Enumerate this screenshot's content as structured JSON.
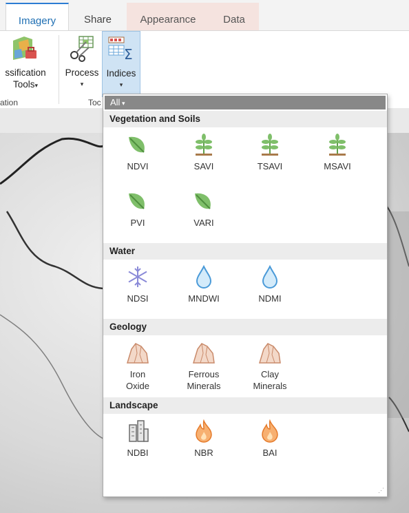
{
  "tabs": [
    {
      "label": "Imagery",
      "active": true
    },
    {
      "label": "Share"
    },
    {
      "label": "Appearance"
    },
    {
      "label": "Data"
    }
  ],
  "ribbon": {
    "classification": {
      "line1": "ssification",
      "line2": "Tools"
    },
    "process": {
      "label": "Process"
    },
    "indices": {
      "label": "Indices"
    },
    "group_left": "ation",
    "group_tools": "Toc"
  },
  "gallery": {
    "filter": "All",
    "sections": [
      {
        "title": "Vegetation and Soils",
        "items": [
          {
            "label": "NDVI",
            "icon": "leaf-icon"
          },
          {
            "label": "SAVI",
            "icon": "plant-icon"
          },
          {
            "label": "TSAVI",
            "icon": "plant-icon"
          },
          {
            "label": "MSAVI",
            "icon": "plant-icon"
          },
          {
            "label": "PVI",
            "icon": "leaf-icon"
          },
          {
            "label": "VARI",
            "icon": "leaf-icon"
          }
        ]
      },
      {
        "title": "Water",
        "items": [
          {
            "label": "NDSI",
            "icon": "snowflake-icon"
          },
          {
            "label": "MNDWI",
            "icon": "water-drop-icon"
          },
          {
            "label": "NDMI",
            "icon": "water-drop-icon"
          }
        ]
      },
      {
        "title": "Geology",
        "items": [
          {
            "label": "Iron\nOxide",
            "line1": "Iron",
            "line2": "Oxide",
            "icon": "rock-icon"
          },
          {
            "label": "Ferrous\nMinerals",
            "line1": "Ferrous",
            "line2": "Minerals",
            "icon": "rock-icon"
          },
          {
            "label": "Clay\nMinerals",
            "line1": "Clay",
            "line2": "Minerals",
            "icon": "rock-icon"
          }
        ]
      },
      {
        "title": "Landscape",
        "items": [
          {
            "label": "NDBI",
            "icon": "buildings-icon"
          },
          {
            "label": "NBR",
            "icon": "fire-icon"
          },
          {
            "label": "BAI",
            "icon": "fire-icon"
          }
        ]
      }
    ]
  },
  "colors": {
    "accent": "#2b7cd3",
    "leaf": "#7fbf6a",
    "water": "#6aaee0",
    "rock": "#d9a890",
    "fire": "#f08a3c"
  }
}
